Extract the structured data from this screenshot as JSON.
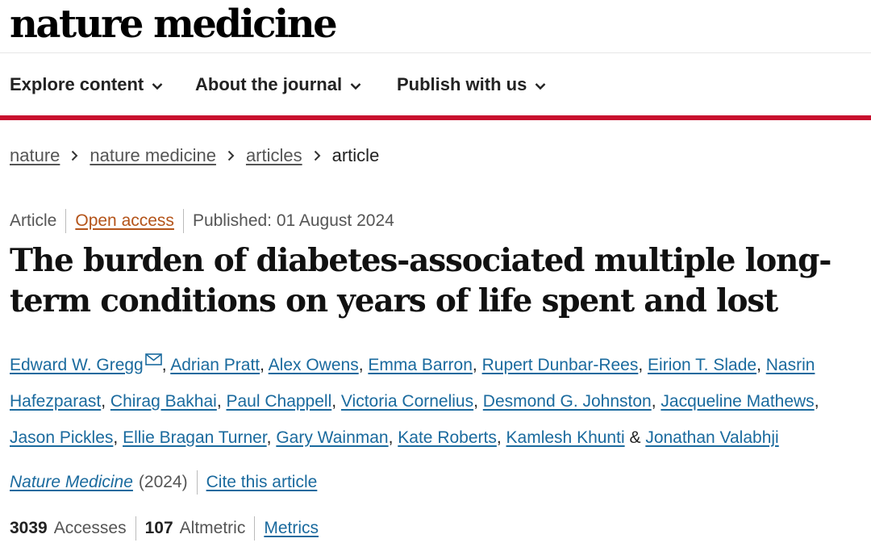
{
  "site": {
    "logo": "nature medicine"
  },
  "nav": {
    "items": [
      {
        "label": "Explore content",
        "icon": "chevron-down-icon"
      },
      {
        "label": "About the journal",
        "icon": "chevron-down-icon"
      },
      {
        "label": "Publish with us",
        "icon": "chevron-down-icon"
      }
    ]
  },
  "breadcrumb": {
    "items": [
      "nature",
      "nature medicine",
      "articles"
    ],
    "current": "article"
  },
  "article": {
    "type": "Article",
    "access": "Open access",
    "published": "Published: 01 August 2024",
    "title": "The burden of diabetes-associated multiple long-term conditions on years of life spent and lost",
    "authors": [
      "Edward W. Gregg",
      "Adrian Pratt",
      "Alex Owens",
      "Emma Barron",
      "Rupert Dunbar-Rees",
      "Eirion T. Slade",
      "Nasrin Hafezparast",
      "Chirag Bakhai",
      "Paul Chappell",
      "Victoria Cornelius",
      "Desmond G. Johnston",
      "Jacqueline Mathews",
      "Jason Pickles",
      "Ellie Bragan Turner",
      "Gary Wainman",
      "Kate Roberts",
      "Kamlesh Khunti",
      "Jonathan Valabhji"
    ],
    "author_separator": ", ",
    "last_separator": " & ",
    "journal": "Nature Medicine",
    "year": "(2024)",
    "cite_label": "Cite this article",
    "accesses_count": "3039",
    "accesses_label": "Accesses",
    "altmetric_count": "107",
    "altmetric_label": "Altmetric",
    "metrics_label": "Metrics"
  },
  "colors": {
    "brand_red": "#c8102e",
    "link": "#1a6a9e",
    "open_access": "#b4541a"
  }
}
